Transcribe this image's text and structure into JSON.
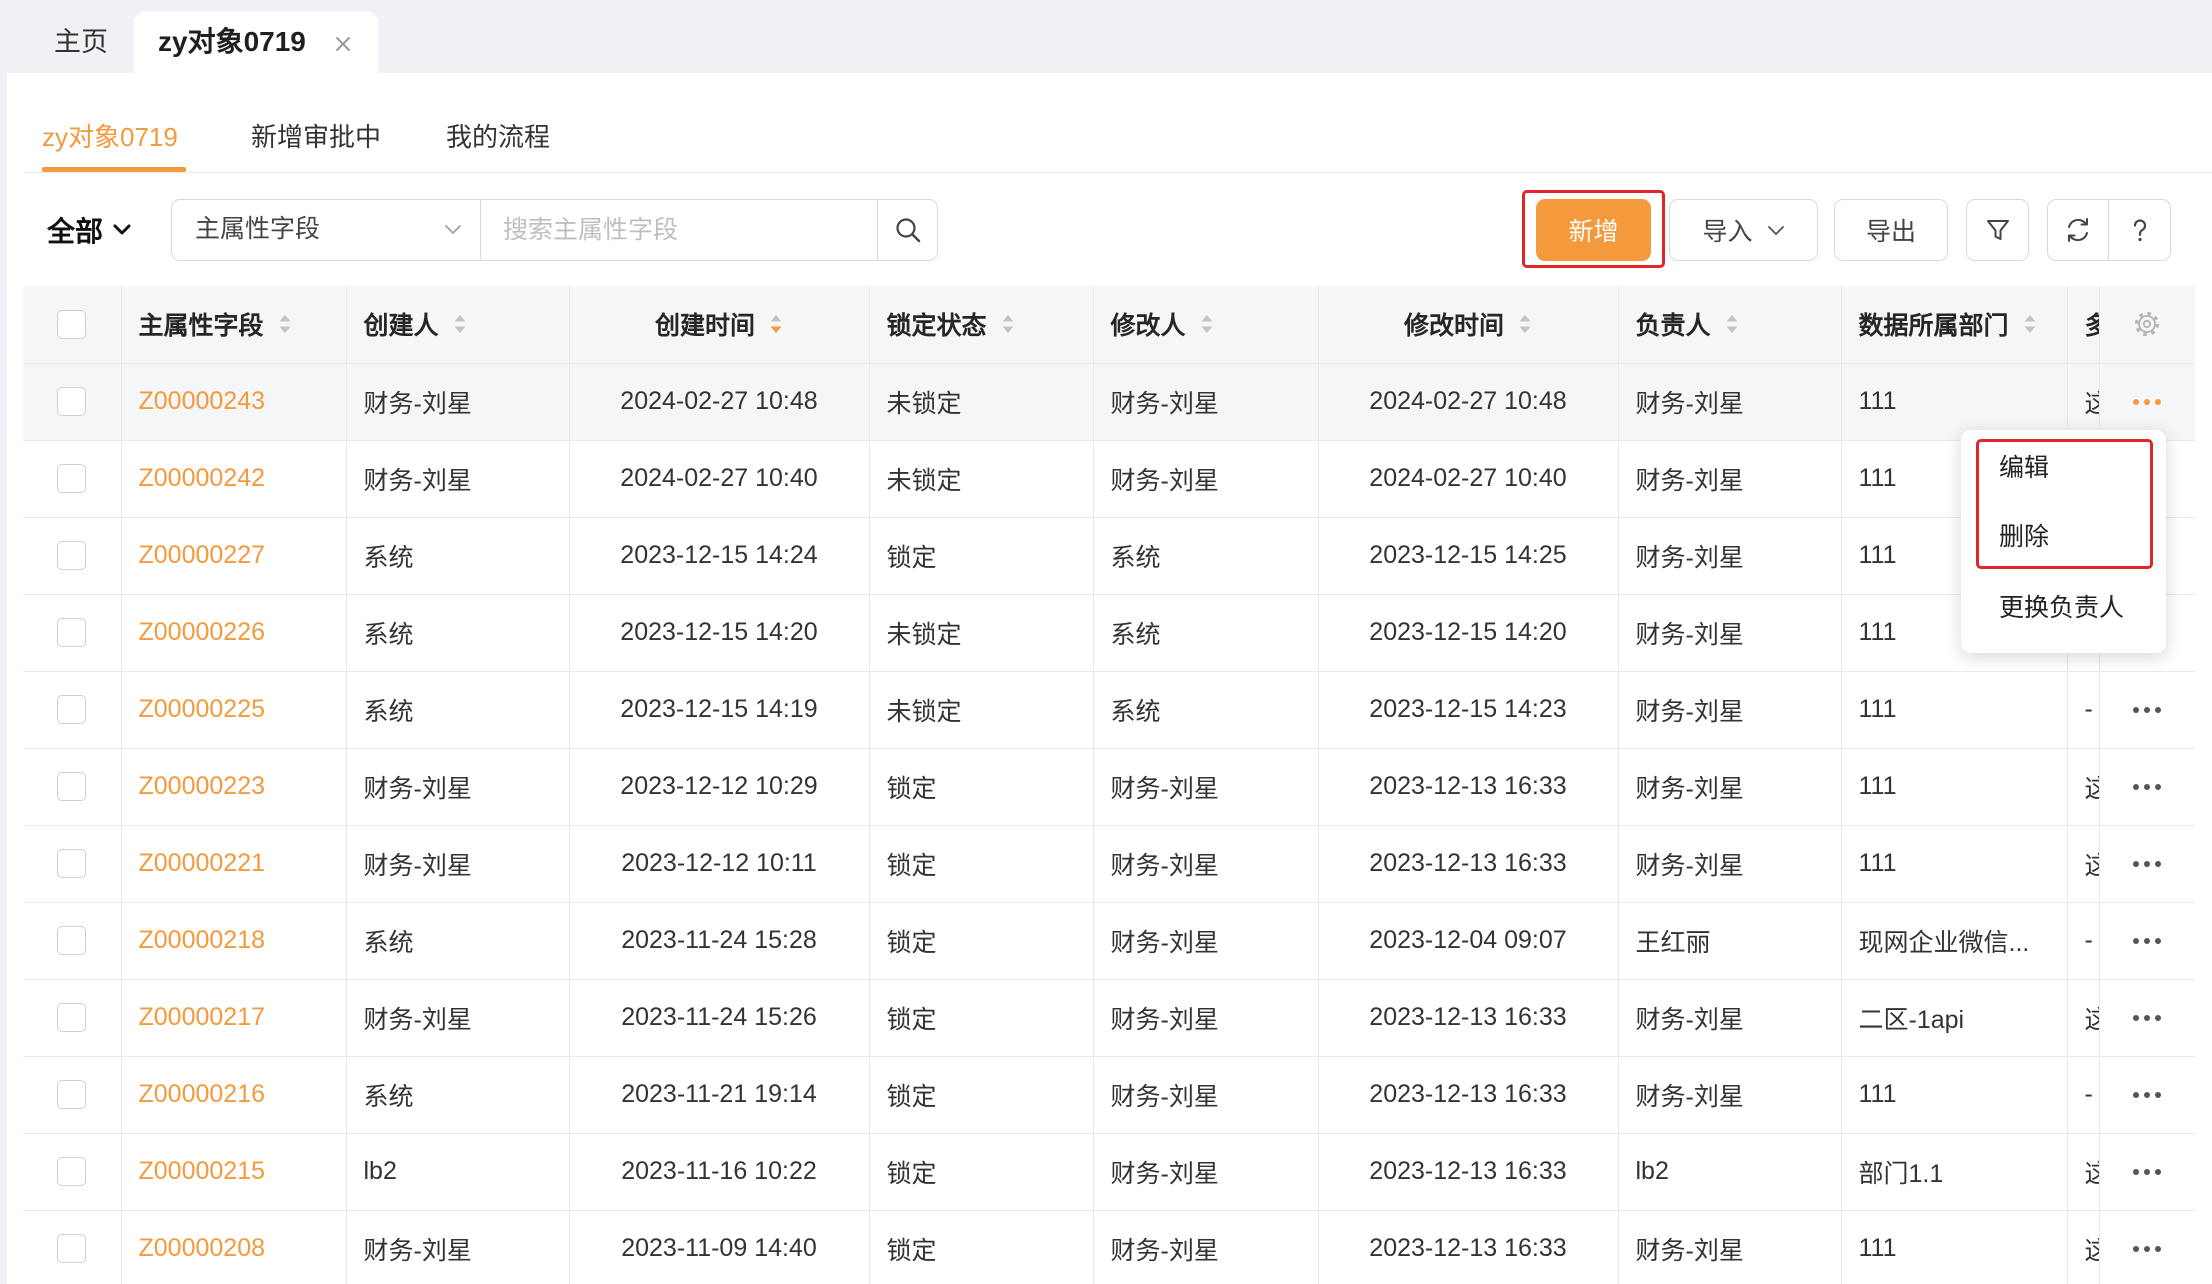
{
  "top_tabs": [
    {
      "label": "主页"
    },
    {
      "label": "zy对象0719"
    }
  ],
  "active_top_tab": 1,
  "sub_tabs": [
    {
      "label": "zy对象0719"
    },
    {
      "label": "新增审批中"
    },
    {
      "label": "我的流程"
    }
  ],
  "active_sub_tab": 0,
  "toolbar": {
    "scope_label": "全部",
    "field_select_value": "主属性字段",
    "search_placeholder": "搜索主属性字段",
    "add_label": "新增",
    "import_label": "导入",
    "export_label": "导出"
  },
  "table": {
    "columns": [
      {
        "label": "主属性字段",
        "sortable": true
      },
      {
        "label": "创建人",
        "sortable": true
      },
      {
        "label": "创建时间",
        "sortable": true,
        "sorted_desc": true
      },
      {
        "label": "锁定状态",
        "sortable": true
      },
      {
        "label": "修改人",
        "sortable": true
      },
      {
        "label": "修改时间",
        "sortable": true
      },
      {
        "label": "负责人",
        "sortable": true
      },
      {
        "label": "数据所属部门",
        "sortable": true
      },
      {
        "label": "多"
      }
    ],
    "active_row": 0,
    "rows": [
      {
        "id": "Z00000243",
        "creator": "财务-刘星",
        "created": "2024-02-27 10:48",
        "lock": "未锁定",
        "modifier": "财务-刘星",
        "modified": "2024-02-27 10:48",
        "owner": "财务-刘星",
        "dept": "111",
        "extra": "这"
      },
      {
        "id": "Z00000242",
        "creator": "财务-刘星",
        "created": "2024-02-27 10:40",
        "lock": "未锁定",
        "modifier": "财务-刘星",
        "modified": "2024-02-27 10:40",
        "owner": "财务-刘星",
        "dept": "111",
        "extra": ""
      },
      {
        "id": "Z00000227",
        "creator": "系统",
        "created": "2023-12-15 14:24",
        "lock": "锁定",
        "modifier": "系统",
        "modified": "2023-12-15 14:25",
        "owner": "财务-刘星",
        "dept": "111",
        "extra": ""
      },
      {
        "id": "Z00000226",
        "creator": "系统",
        "created": "2023-12-15 14:20",
        "lock": "未锁定",
        "modifier": "系统",
        "modified": "2023-12-15 14:20",
        "owner": "财务-刘星",
        "dept": "111",
        "extra": ""
      },
      {
        "id": "Z00000225",
        "creator": "系统",
        "created": "2023-12-15 14:19",
        "lock": "未锁定",
        "modifier": "系统",
        "modified": "2023-12-15 14:23",
        "owner": "财务-刘星",
        "dept": "111",
        "extra": "-"
      },
      {
        "id": "Z00000223",
        "creator": "财务-刘星",
        "created": "2023-12-12 10:29",
        "lock": "锁定",
        "modifier": "财务-刘星",
        "modified": "2023-12-13 16:33",
        "owner": "财务-刘星",
        "dept": "111",
        "extra": "这"
      },
      {
        "id": "Z00000221",
        "creator": "财务-刘星",
        "created": "2023-12-12 10:11",
        "lock": "锁定",
        "modifier": "财务-刘星",
        "modified": "2023-12-13 16:33",
        "owner": "财务-刘星",
        "dept": "111",
        "extra": "这"
      },
      {
        "id": "Z00000218",
        "creator": "系统",
        "created": "2023-11-24 15:28",
        "lock": "锁定",
        "modifier": "财务-刘星",
        "modified": "2023-12-04 09:07",
        "owner": "王红丽",
        "dept": "现网企业微信...",
        "extra": "-"
      },
      {
        "id": "Z00000217",
        "creator": "财务-刘星",
        "created": "2023-11-24 15:26",
        "lock": "锁定",
        "modifier": "财务-刘星",
        "modified": "2023-12-13 16:33",
        "owner": "财务-刘星",
        "dept": "二区-1api",
        "extra": "这"
      },
      {
        "id": "Z00000216",
        "creator": "系统",
        "created": "2023-11-21 19:14",
        "lock": "锁定",
        "modifier": "财务-刘星",
        "modified": "2023-12-13 16:33",
        "owner": "财务-刘星",
        "dept": "111",
        "extra": "-"
      },
      {
        "id": "Z00000215",
        "creator": "lb2",
        "created": "2023-11-16 10:22",
        "lock": "锁定",
        "modifier": "财务-刘星",
        "modified": "2023-12-13 16:33",
        "owner": "lb2",
        "dept": "部门1.1",
        "extra": "这"
      },
      {
        "id": "Z00000208",
        "creator": "财务-刘星",
        "created": "2023-11-09 14:40",
        "lock": "锁定",
        "modifier": "财务-刘星",
        "modified": "2023-12-13 16:33",
        "owner": "财务-刘星",
        "dept": "111",
        "extra": "这"
      }
    ]
  },
  "row_menu": {
    "items": [
      "编辑",
      "删除",
      "更换负责人"
    ]
  },
  "colors": {
    "accent": "#f5993d",
    "highlight_box": "#e0262b"
  },
  "icons": {
    "tab_close": "close-icon",
    "scope_toggle": "chevron-down-icon",
    "field_select": "chevron-down-icon",
    "search": "search-icon",
    "import_menu": "chevron-down-icon",
    "filter": "filter-icon",
    "refresh": "refresh-icon",
    "help": "help-icon",
    "column_settings": "gear-icon",
    "row_actions": "more-icon",
    "sort": "sort-icon"
  }
}
